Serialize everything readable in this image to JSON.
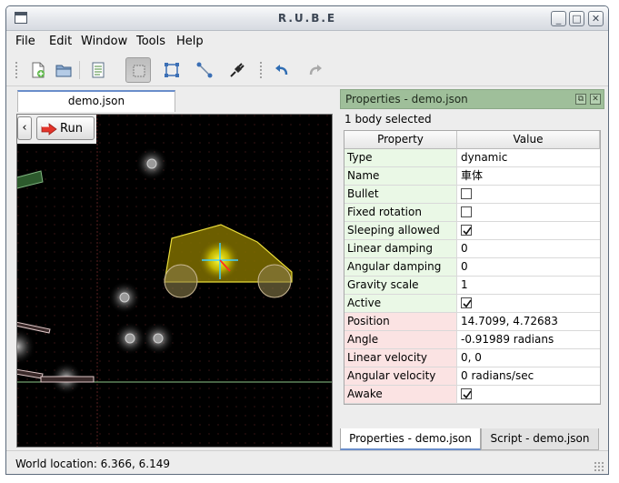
{
  "window": {
    "title": "R.U.B.E"
  },
  "menu": [
    "File",
    "Edit",
    "Window",
    "Tools",
    "Help"
  ],
  "toolbar": {
    "icons": [
      "new-file-icon",
      "open-folder-icon",
      "document-properties-icon",
      "select-mode-icon",
      "edit-shape-icon",
      "edit-joint-icon",
      "plug-icon",
      "undo-icon",
      "redo-icon"
    ],
    "active_tool": "select-mode-icon"
  },
  "editor": {
    "tab_label": "demo.json",
    "collapse_label": "‹",
    "run_label": "Run"
  },
  "properties": {
    "panel_title": "Properties - demo.json",
    "selection_text": "1 body selected",
    "columns": [
      "Property",
      "Value"
    ],
    "rows": [
      {
        "property": "Type",
        "value": "dynamic",
        "kind": "text",
        "group": "green"
      },
      {
        "property": "Name",
        "value": "車体",
        "kind": "text",
        "group": "green"
      },
      {
        "property": "Bullet",
        "value": "",
        "kind": "checkbox",
        "checked": false,
        "group": "green"
      },
      {
        "property": "Fixed rotation",
        "value": "",
        "kind": "checkbox",
        "checked": false,
        "group": "green"
      },
      {
        "property": "Sleeping allowed",
        "value": "",
        "kind": "checkbox",
        "checked": true,
        "group": "green"
      },
      {
        "property": "Linear damping",
        "value": "0",
        "kind": "text",
        "group": "green"
      },
      {
        "property": "Angular damping",
        "value": "0",
        "kind": "text",
        "group": "green"
      },
      {
        "property": "Gravity scale",
        "value": "1",
        "kind": "text",
        "group": "green"
      },
      {
        "property": "Active",
        "value": "",
        "kind": "checkbox",
        "checked": true,
        "group": "green"
      },
      {
        "property": "Position",
        "value": "14.7099, 4.72683",
        "kind": "text",
        "group": "pink"
      },
      {
        "property": "Angle",
        "value": "-0.91989 radians",
        "kind": "text",
        "group": "pink"
      },
      {
        "property": "Linear velocity",
        "value": "0, 0",
        "kind": "text",
        "group": "pink"
      },
      {
        "property": "Angular velocity",
        "value": "0 radians/sec",
        "kind": "text",
        "group": "pink"
      },
      {
        "property": "Awake",
        "value": "",
        "kind": "checkbox",
        "checked": true,
        "group": "pink"
      }
    ]
  },
  "bottom_tabs": [
    "Properties - demo.json",
    "Script - demo.json"
  ],
  "status": {
    "text": "World location: 6.366, 6.149"
  }
}
